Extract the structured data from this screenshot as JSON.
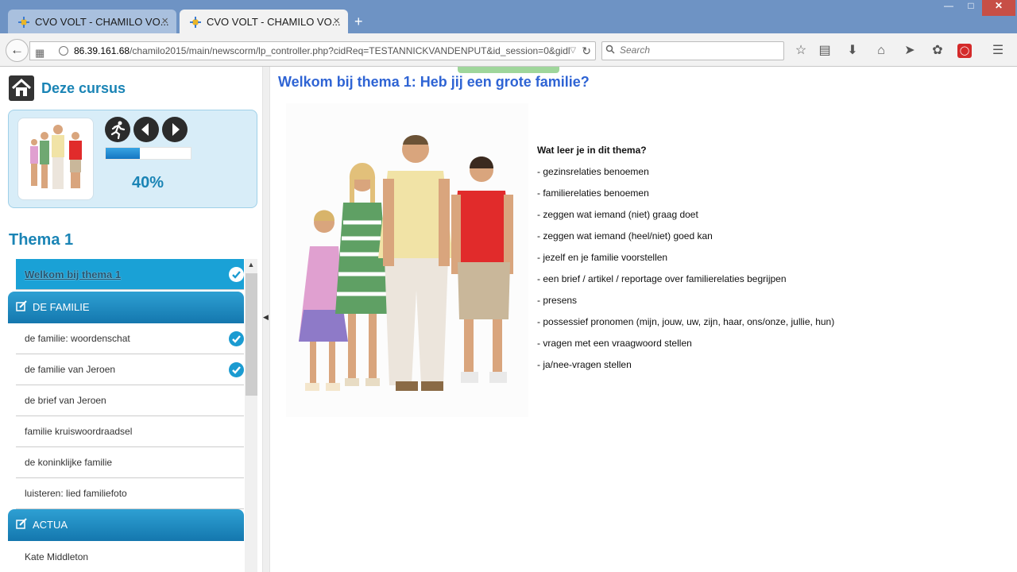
{
  "browser": {
    "tabs": [
      {
        "title": "CVO VOLT - CHAMILO VO...",
        "active": false
      },
      {
        "title": "CVO VOLT - CHAMILO VO...",
        "active": true
      }
    ],
    "new_tab": "+",
    "close": "×",
    "url_host": "86.39.161.68",
    "url_path": "/chamilo2015/main/newscorm/lp_controller.php?cidReq=TESTANNICKVANDENPUT&id_session=0&gidl",
    "search_placeholder": "Search"
  },
  "sidebar": {
    "course_title": "Deze cursus",
    "progress_percent": 40,
    "progress_label": "40%",
    "section_title": "Thema 1",
    "items": [
      {
        "label": "Welkom bij thema 1",
        "current": true,
        "done": true
      },
      {
        "label": "DE FAMILIE",
        "header": true
      },
      {
        "label": "de familie: woordenschat",
        "done": true
      },
      {
        "label": "de familie van Jeroen",
        "done": true
      },
      {
        "label": "de brief van Jeroen",
        "done": false
      },
      {
        "label": "familie kruiswoordraadsel",
        "done": false
      },
      {
        "label": "de koninklijke familie",
        "done": false
      },
      {
        "label": "luisteren: lied familiefoto",
        "done": false
      },
      {
        "label": "ACTUA",
        "header": true
      },
      {
        "label": "Kate Middleton",
        "done": false
      }
    ]
  },
  "main": {
    "title": "Welkom bij thema 1: Heb jij een grote familie?",
    "question": "Wat leer je in dit thema?",
    "goals": [
      "gezinsrelaties benoemen",
      "familierelaties benoemen",
      "zeggen wat iemand (niet) graag doet",
      "zeggen wat iemand (heel/niet) goed kan",
      "jezelf en je familie voorstellen",
      "een brief / artikel / reportage over familierelaties begrijpen",
      "presens",
      "possessief pronomen (mijn, jouw, uw, zijn, haar, ons/onze, jullie, hun)",
      "vragen met een vraagwoord stellen",
      "ja/nee-vragen stellen"
    ]
  },
  "colors": {
    "accent": "#1a84b5",
    "title_blue": "#2f64d4",
    "toc_header": "#1a8cc4",
    "chrome": "#6e93c4"
  }
}
